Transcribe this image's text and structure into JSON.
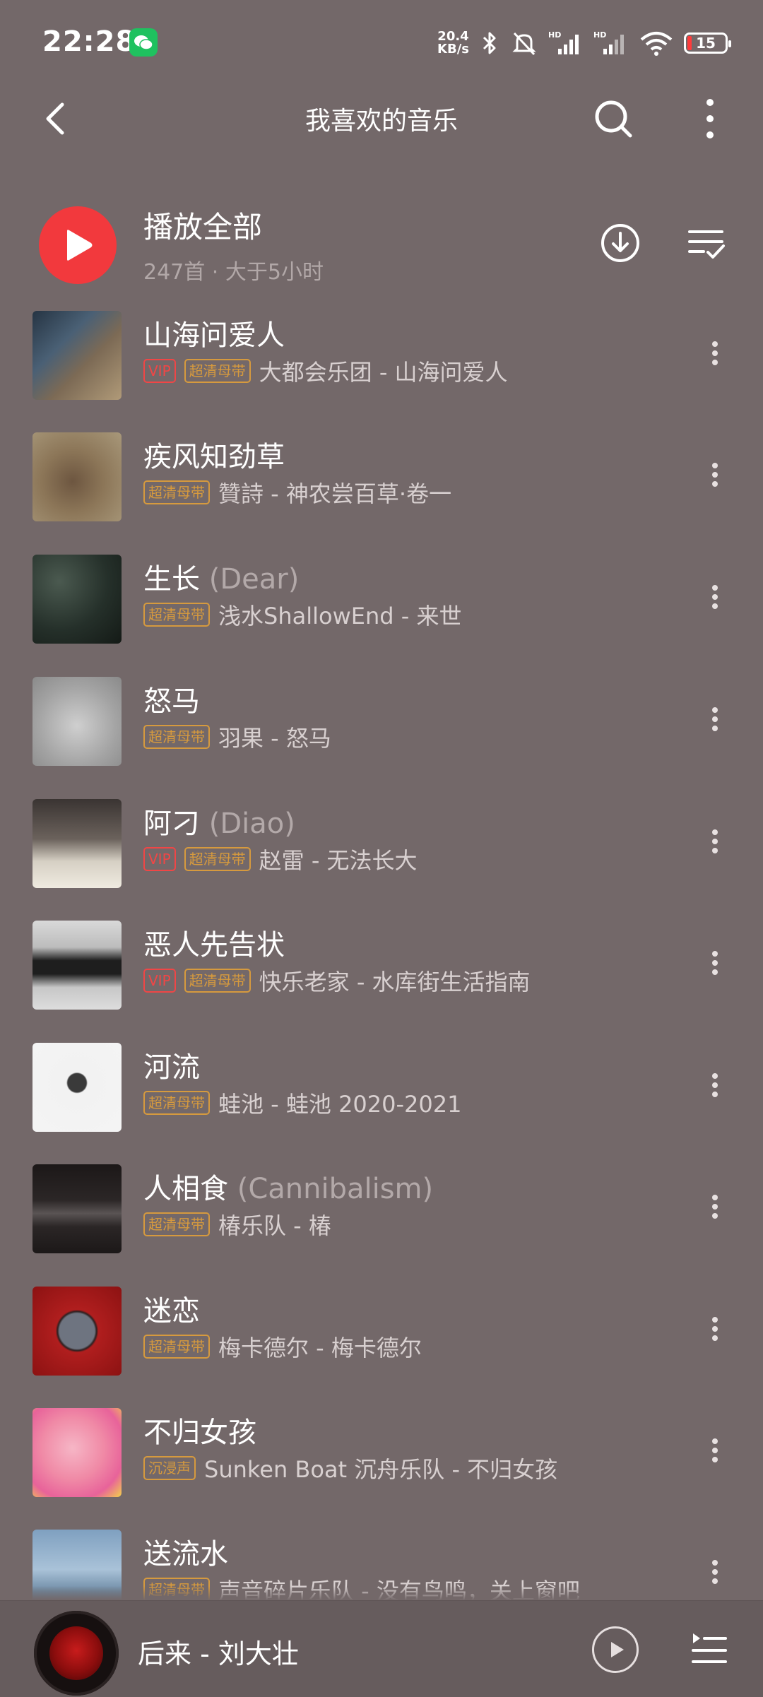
{
  "status_bar": {
    "time": "22:28",
    "net_speed_value": "20.4",
    "net_speed_unit": "KB/s",
    "battery": "15",
    "icons": [
      "wechat-icon",
      "bluetooth-icon",
      "mute-bell-icon",
      "signal-icon",
      "signal-icon",
      "wifi-icon",
      "battery-icon"
    ]
  },
  "header": {
    "title": "我喜欢的音乐"
  },
  "play_all": {
    "title": "播放全部",
    "subtitle": "247首 · 大于5小时"
  },
  "songs": [
    {
      "title": "山海问爱人",
      "alias": "",
      "tags": [
        "VIP",
        "超清母带"
      ],
      "artist_album": "大都会乐团 - 山海问爱人"
    },
    {
      "title": "疾风知劲草",
      "alias": "",
      "tags": [
        "超清母带"
      ],
      "artist_album": "贊詩 - 神农尝百草·卷一"
    },
    {
      "title": "生长",
      "alias": "(Dear)",
      "tags": [
        "超清母带"
      ],
      "artist_album": "浅水ShallowEnd - 来世"
    },
    {
      "title": "怒马",
      "alias": "",
      "tags": [
        "超清母带"
      ],
      "artist_album": "羽果 - 怒马"
    },
    {
      "title": "阿刁",
      "alias": "(Diao)",
      "tags": [
        "VIP",
        "超清母带"
      ],
      "artist_album": "赵雷 - 无法长大"
    },
    {
      "title": "恶人先告状",
      "alias": "",
      "tags": [
        "VIP",
        "超清母带"
      ],
      "artist_album": "快乐老家 - 水库街生活指南"
    },
    {
      "title": "河流",
      "alias": "",
      "tags": [
        "超清母带"
      ],
      "artist_album": "蛙池 - 蛙池 2020-2021"
    },
    {
      "title": "人相食",
      "alias": "(Cannibalism)",
      "tags": [
        "超清母带"
      ],
      "artist_album": "椿乐队 - 椿"
    },
    {
      "title": "迷恋",
      "alias": "",
      "tags": [
        "超清母带"
      ],
      "artist_album": "梅卡德尔 - 梅卡德尔"
    },
    {
      "title": "不归女孩",
      "alias": "",
      "tags": [
        "沉浸声"
      ],
      "artist_album": "Sunken Boat 沉舟乐队 - 不归女孩"
    },
    {
      "title": "送流水",
      "alias": "",
      "tags": [
        "超清母带"
      ],
      "artist_album": "声音碎片乐队 - 没有鸟鸣，关上窗吧"
    }
  ],
  "mini_player": {
    "now_playing": "后来 - 刘大壮"
  },
  "colors": {
    "background": "#736869",
    "accent": "#f2393d",
    "vip": "#f04646",
    "hq": "#d69a3e"
  },
  "covers": [
    "covers/shanhai-wen-airen.jpg",
    "covers/shennong-changbaicao-juanyi.jpg",
    "covers/laishi.jpg",
    "covers/numa.jpg",
    "covers/wufa-zhangda.jpg",
    "covers/shuikujie-shenghuo-zhinan.jpg",
    "covers/wachi-2020-2021.jpg",
    "covers/chun.jpg",
    "covers/meikadeer.jpg",
    "covers/bugui-nvhai.jpg",
    "covers/meiyou-niaoming.jpg"
  ]
}
